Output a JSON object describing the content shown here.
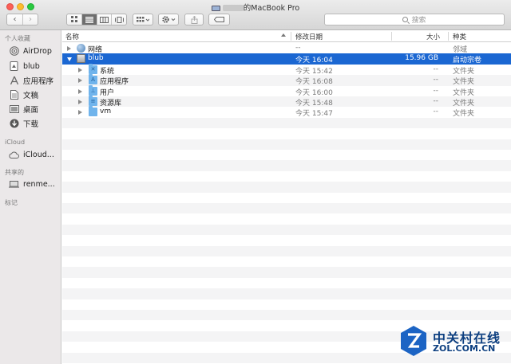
{
  "window": {
    "title": "的MacBook Pro",
    "icon": "laptop-icon"
  },
  "toolbar": {
    "back": "‹",
    "forward": "›",
    "search_placeholder": "搜索"
  },
  "sidebar": {
    "sections": [
      {
        "header": "个人收藏",
        "items": [
          {
            "label": "AirDrop",
            "icon": "airdrop-icon"
          },
          {
            "label": "blub",
            "icon": "house-icon"
          },
          {
            "label": "应用程序",
            "icon": "apps-icon"
          },
          {
            "label": "文稿",
            "icon": "document-icon"
          },
          {
            "label": "桌面",
            "icon": "desktop-icon"
          },
          {
            "label": "下载",
            "icon": "download-icon"
          }
        ]
      },
      {
        "header": "iCloud",
        "items": [
          {
            "label": "iCloud...",
            "icon": "cloud-icon"
          }
        ]
      },
      {
        "header": "共享的",
        "items": [
          {
            "label": "renme...",
            "icon": "computer-icon"
          }
        ]
      },
      {
        "header": "标记",
        "items": []
      }
    ]
  },
  "columns": {
    "name": "名称",
    "date": "修改日期",
    "size": "大小",
    "kind": "种类"
  },
  "rows": [
    {
      "name": "网络",
      "date": "--",
      "size": "",
      "kind": "邻域",
      "icon": "globe-icon",
      "level": 0,
      "expanded": false,
      "selected": false
    },
    {
      "name": "blub",
      "date": "今天 16:04",
      "size": "15.96 GB",
      "kind": "启动宗卷",
      "icon": "disk-icon",
      "level": 0,
      "expanded": true,
      "selected": true
    },
    {
      "name": "系统",
      "date": "今天 15:42",
      "size": "--",
      "kind": "文件夹",
      "icon": "system-folder-icon",
      "level": 1,
      "expanded": false,
      "selected": false
    },
    {
      "name": "应用程序",
      "date": "今天 16:08",
      "size": "--",
      "kind": "文件夹",
      "icon": "apps-folder-icon",
      "level": 1,
      "expanded": false,
      "selected": false
    },
    {
      "name": "用户",
      "date": "今天 16:00",
      "size": "--",
      "kind": "文件夹",
      "icon": "users-folder-icon",
      "level": 1,
      "expanded": false,
      "selected": false
    },
    {
      "name": "资源库",
      "date": "今天 15:48",
      "size": "--",
      "kind": "文件夹",
      "icon": "library-folder-icon",
      "level": 1,
      "expanded": false,
      "selected": false
    },
    {
      "name": "vm",
      "date": "今天 15:47",
      "size": "--",
      "kind": "文件夹",
      "icon": "folder-icon",
      "level": 1,
      "expanded": false,
      "selected": false
    }
  ],
  "watermark": {
    "cn": "中关村在线",
    "en": "ZOL.COM.CN"
  },
  "colors": {
    "selection": "#1b67d2",
    "sidebar_bg": "#ebe8e9",
    "folder": "#70b4ec",
    "watermark": "#0d3f80"
  }
}
